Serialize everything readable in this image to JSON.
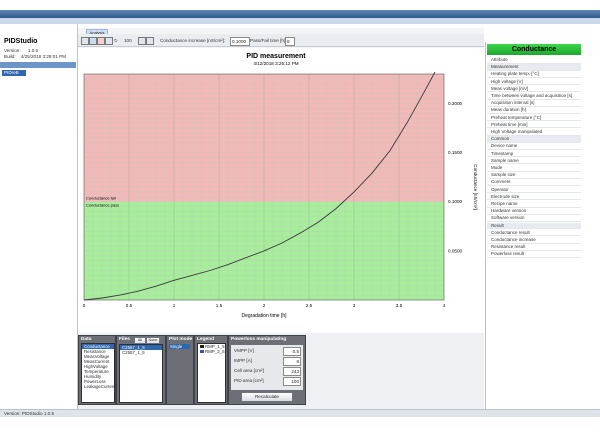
{
  "app": {
    "name": "PIDStudio",
    "version_label": "Version:",
    "version": "1.0.5",
    "build_label": "Build:",
    "build": "4/25/2018 3:29:01 PM",
    "left_selected": "PIDreB"
  },
  "toolbar": {
    "tab_label": "Analysis",
    "zoom_value": "100",
    "conductance_increase_label": "Conductance increase [nS/cm²]:",
    "conductance_increase_value": "0.1000",
    "pass_fail_label": "Pass/Fail time [h]:",
    "pass_fail_value": "8"
  },
  "chart_data": {
    "type": "line",
    "title": "PID measurement",
    "subtitle": "4/12/2018 3:25:12 PM",
    "xlabel": "Degradation time [h]",
    "ylabel": "Conductance [nS/cm²]",
    "xlim": [
      0,
      4
    ],
    "ylim": [
      0,
      0.23
    ],
    "x_ticks": [
      "0",
      "0.5",
      "1",
      "1.5",
      "2",
      "2.5",
      "3",
      "3.5",
      "4"
    ],
    "y_ticks": [
      "0.0500",
      "0.1000",
      "0.1500",
      "0.2000"
    ],
    "threshold": 0.1,
    "zone_labels": [
      "Conductance fail",
      "Conductance pass"
    ],
    "zone_colors": {
      "fail": "#f2b9b9",
      "pass": "#a7ed9c"
    },
    "line_color": "#3a3a3a",
    "grid": true,
    "series": [
      {
        "x": [
          0,
          0.2,
          0.4,
          0.6,
          0.8,
          1.0,
          1.2,
          1.4,
          1.6,
          1.8,
          2.0,
          2.2,
          2.4,
          2.6,
          2.8,
          3.0,
          3.2,
          3.4,
          3.6,
          3.8,
          3.9
        ],
        "values": [
          0.0,
          0.002,
          0.005,
          0.009,
          0.014,
          0.02,
          0.025,
          0.03,
          0.036,
          0.043,
          0.05,
          0.058,
          0.068,
          0.079,
          0.093,
          0.11,
          0.129,
          0.152,
          0.182,
          0.215,
          0.232
        ]
      }
    ]
  },
  "panels": {
    "data": {
      "title": "Data",
      "items": [
        "Conductance",
        "Resistance",
        "MeasVoltage",
        "MeasCurrent",
        "HighVoltage",
        "Temperature",
        "Humidity",
        "PowerLoss",
        "LeakageCurrent"
      ],
      "selected_index": 0
    },
    "files": {
      "title": "Files",
      "button_all": "All",
      "button_none": "None",
      "items": [
        "C2557_1_5",
        "C2557_1_5"
      ]
    },
    "plot_mode": {
      "title": "Plot mode",
      "value": "Single"
    },
    "legend": {
      "title": "Legend",
      "items": [
        "RMP_1_5",
        "RMP_2_5"
      ]
    },
    "powerloss": {
      "title": "Powerloss manipulating",
      "rows": [
        {
          "label": "VMPP [V]",
          "value": "0.5"
        },
        {
          "label": "IMPP [A]",
          "value": "8"
        },
        {
          "label": "Cell area [cm²]",
          "value": "243"
        },
        {
          "label": "PID area [cm²]",
          "value": "100"
        }
      ],
      "button": "Recalculate"
    }
  },
  "right_panel": {
    "header": "Conductance",
    "rows": [
      {
        "text": "Attribute",
        "cat": false
      },
      {
        "text": "Measurement",
        "cat": true
      },
      {
        "text": "Heating plate temp. [°C]",
        "cat": false
      },
      {
        "text": "High voltage [V]",
        "cat": false
      },
      {
        "text": "Meas voltage [mV]",
        "cat": false
      },
      {
        "text": "Time between voltage and acquisition [s]",
        "cat": false
      },
      {
        "text": "Acquisition interval [s]",
        "cat": false
      },
      {
        "text": "Meas duration [h]",
        "cat": false
      },
      {
        "text": "Preheat temperature [°C]",
        "cat": false
      },
      {
        "text": "Preheat time [min]",
        "cat": false
      },
      {
        "text": "High Voltage manipulated",
        "cat": false
      },
      {
        "text": "Common",
        "cat": true
      },
      {
        "text": "Device name",
        "cat": false
      },
      {
        "text": "Timestamp",
        "cat": false
      },
      {
        "text": "Sample name",
        "cat": false
      },
      {
        "text": "Mode",
        "cat": false
      },
      {
        "text": "Sample size",
        "cat": false
      },
      {
        "text": "Comment",
        "cat": false
      },
      {
        "text": "Operator",
        "cat": false
      },
      {
        "text": "Electrode size",
        "cat": false
      },
      {
        "text": "Recipe name",
        "cat": false
      },
      {
        "text": "Hardware version",
        "cat": false
      },
      {
        "text": "Software version",
        "cat": false
      },
      {
        "text": "Result",
        "cat": true
      },
      {
        "text": "Conductance result",
        "cat": false
      },
      {
        "text": "Conductance increase",
        "cat": false
      },
      {
        "text": "Resistance result",
        "cat": false
      },
      {
        "text": "Powerloss result",
        "cat": false
      }
    ]
  },
  "status": {
    "text": "Version: PIDStudio 1.0.5"
  }
}
